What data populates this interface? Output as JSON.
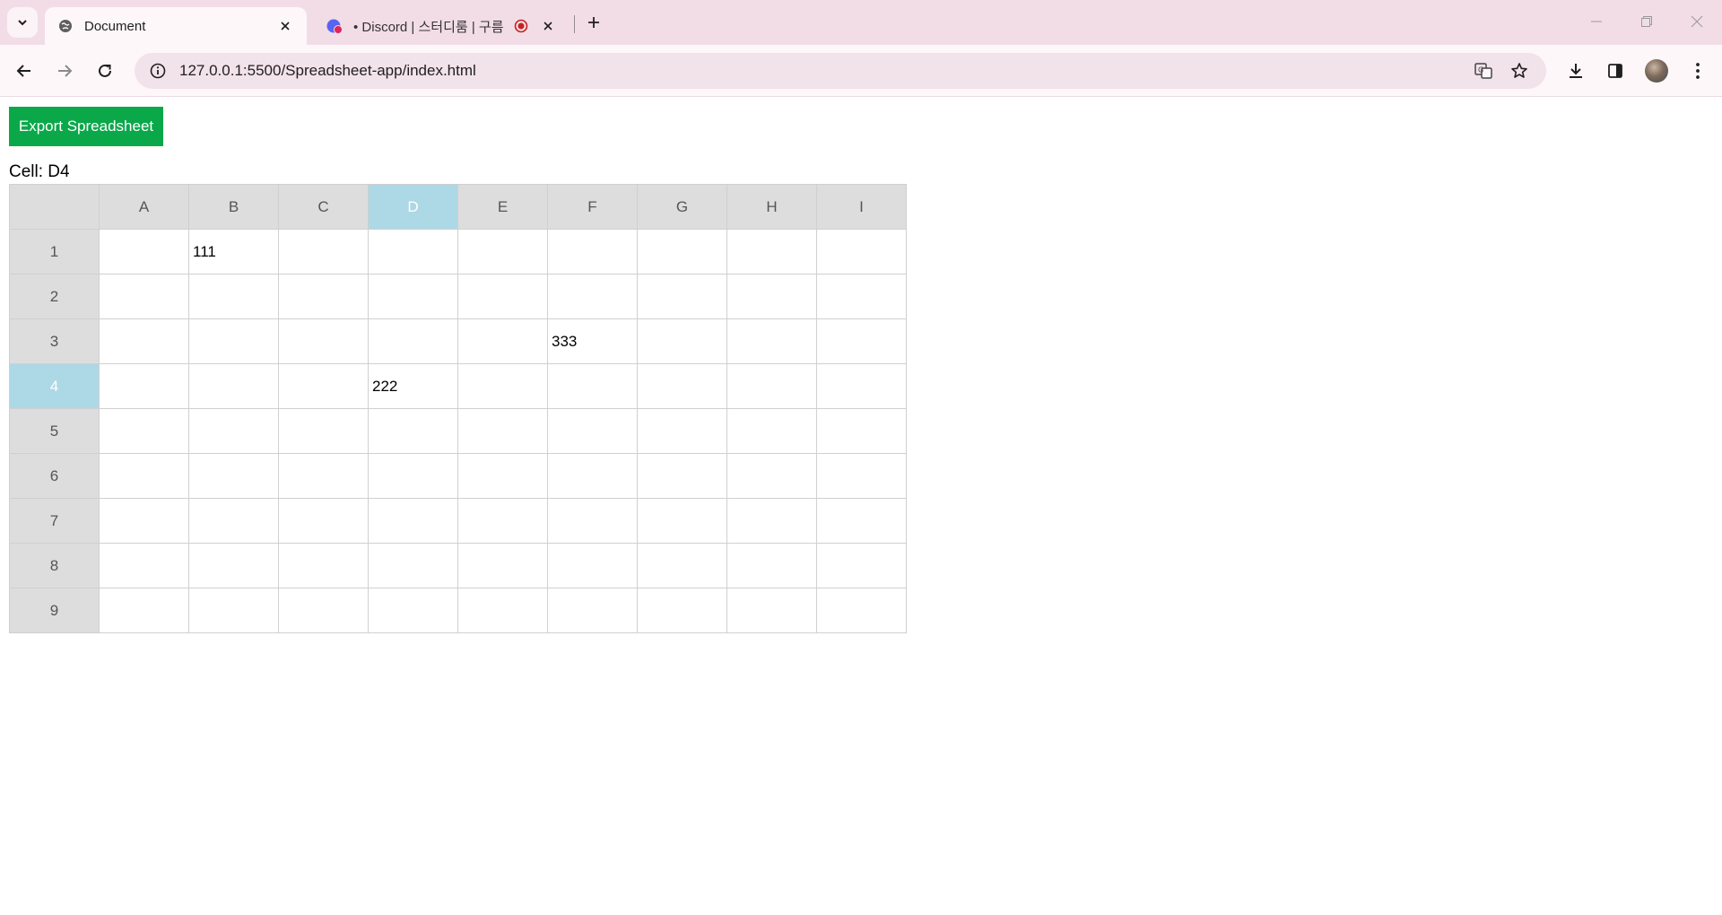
{
  "browser": {
    "tabs": [
      {
        "title": "Document",
        "active": true,
        "icon": "globe-icon"
      },
      {
        "title": "• Discord | 스터디룸 | 구름",
        "active": false,
        "icon": "discord-icon",
        "recording": true
      }
    ],
    "url": "127.0.0.1:5500/Spreadsheet-app/index.html"
  },
  "page": {
    "export_label": "Export Spreadsheet",
    "cell_label": "Cell: D4",
    "columns": [
      "A",
      "B",
      "C",
      "D",
      "E",
      "F",
      "G",
      "H",
      "I"
    ],
    "rows": [
      "1",
      "2",
      "3",
      "4",
      "5",
      "6",
      "7",
      "8",
      "9"
    ],
    "selected": {
      "column": "D",
      "row": "4"
    },
    "cells": [
      [
        "",
        "111",
        "",
        "",
        "",
        "",
        "",
        "",
        ""
      ],
      [
        "",
        "",
        "",
        "",
        "",
        "",
        "",
        "",
        ""
      ],
      [
        "",
        "",
        "",
        "",
        "",
        "333",
        "",
        "",
        ""
      ],
      [
        "",
        "",
        "",
        "222",
        "",
        "",
        "",
        "",
        ""
      ],
      [
        "",
        "",
        "",
        "",
        "",
        "",
        "",
        "",
        ""
      ],
      [
        "",
        "",
        "",
        "",
        "",
        "",
        "",
        "",
        ""
      ],
      [
        "",
        "",
        "",
        "",
        "",
        "",
        "",
        "",
        ""
      ],
      [
        "",
        "",
        "",
        "",
        "",
        "",
        "",
        "",
        ""
      ],
      [
        "",
        "",
        "",
        "",
        "",
        "",
        "",
        "",
        ""
      ]
    ]
  },
  "colors": {
    "export_button": "#0ba84a",
    "header_bg": "#dddddd",
    "selected_header_bg": "#add8e6",
    "tabstrip_bg": "#f2dde6"
  }
}
